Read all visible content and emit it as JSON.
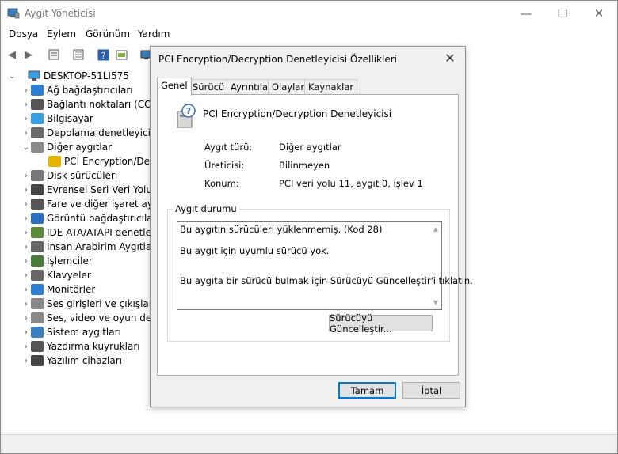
{
  "window": {
    "title": "Aygıt Yöneticisi",
    "minimize": "—",
    "maximize": "☐",
    "close": "✕"
  },
  "menu": [
    "Dosya",
    "Eylem",
    "Görünüm",
    "Yardım"
  ],
  "tree": {
    "root": "DESKTOP-51LI575",
    "items": [
      {
        "label": "Ağ bağdaştırıcıları",
        "color": "#2d7fd3"
      },
      {
        "label": "Bağlantı noktaları (COM",
        "color": "#555555"
      },
      {
        "label": "Bilgisayar",
        "color": "#3a9ee4"
      },
      {
        "label": "Depolama denetleyicileri",
        "color": "#6b6b6b"
      },
      {
        "label": "Diğer aygıtlar",
        "color": "#8a8a8a"
      },
      {
        "label": "PCI Encryption/Decr",
        "color": "#e8b400"
      },
      {
        "label": "Disk sürücüleri",
        "color": "#777777"
      },
      {
        "label": "Evrensel Seri Veri Yolu de",
        "color": "#444444"
      },
      {
        "label": "Fare ve diğer işaret aygıt",
        "color": "#555555"
      },
      {
        "label": "Görüntü bağdaştırıcılar",
        "color": "#2a6fc0"
      },
      {
        "label": "IDE ATA/ATAPI denetleyi",
        "color": "#5a8a3a"
      },
      {
        "label": "İnsan Arabirim Aygıtlar",
        "color": "#666666"
      },
      {
        "label": "İşlemciler",
        "color": "#4a7a3a"
      },
      {
        "label": "Klavyeler",
        "color": "#666666"
      },
      {
        "label": "Monitörler",
        "color": "#2d7fd3"
      },
      {
        "label": "Ses girişleri ve çıkışları",
        "color": "#888888"
      },
      {
        "label": "Ses, video ve oyun dene",
        "color": "#888888"
      },
      {
        "label": "Sistem aygıtları",
        "color": "#3a7fc0"
      },
      {
        "label": "Yazdırma kuyrukları",
        "color": "#555555"
      },
      {
        "label": "Yazılım cihazları",
        "color": "#444444"
      }
    ]
  },
  "dialog": {
    "title": "PCI Encryption/Decryption Denetleyicisi Özellikleri",
    "close": "✕",
    "tabs": [
      "Genel",
      "Sürücü",
      "Ayrıntılar",
      "Olaylar",
      "Kaynaklar"
    ],
    "device_name": "PCI Encryption/Decryption Denetleyicisi",
    "props": [
      {
        "label": "Aygıt türü:",
        "value": "Diğer aygıtlar"
      },
      {
        "label": "Üreticisi:",
        "value": "Bilinmeyen"
      },
      {
        "label": "Konum:",
        "value": "PCI veri yolu 11, aygıt 0, işlev 1"
      }
    ],
    "status_group_title": "Aygıt durumu",
    "status_lines": [
      "Bu aygıtın sürücüleri yüklenmemiş. (Kod 28)",
      "Bu aygıt için uyumlu sürücü yok.",
      "Bu aygıta bir sürücü bulmak için Sürücüyü Güncelleştir'i tıklatın."
    ],
    "update_button": "Sürücüyü Güncelleştir...",
    "ok_button": "Tamam",
    "cancel_button": "İptal"
  }
}
